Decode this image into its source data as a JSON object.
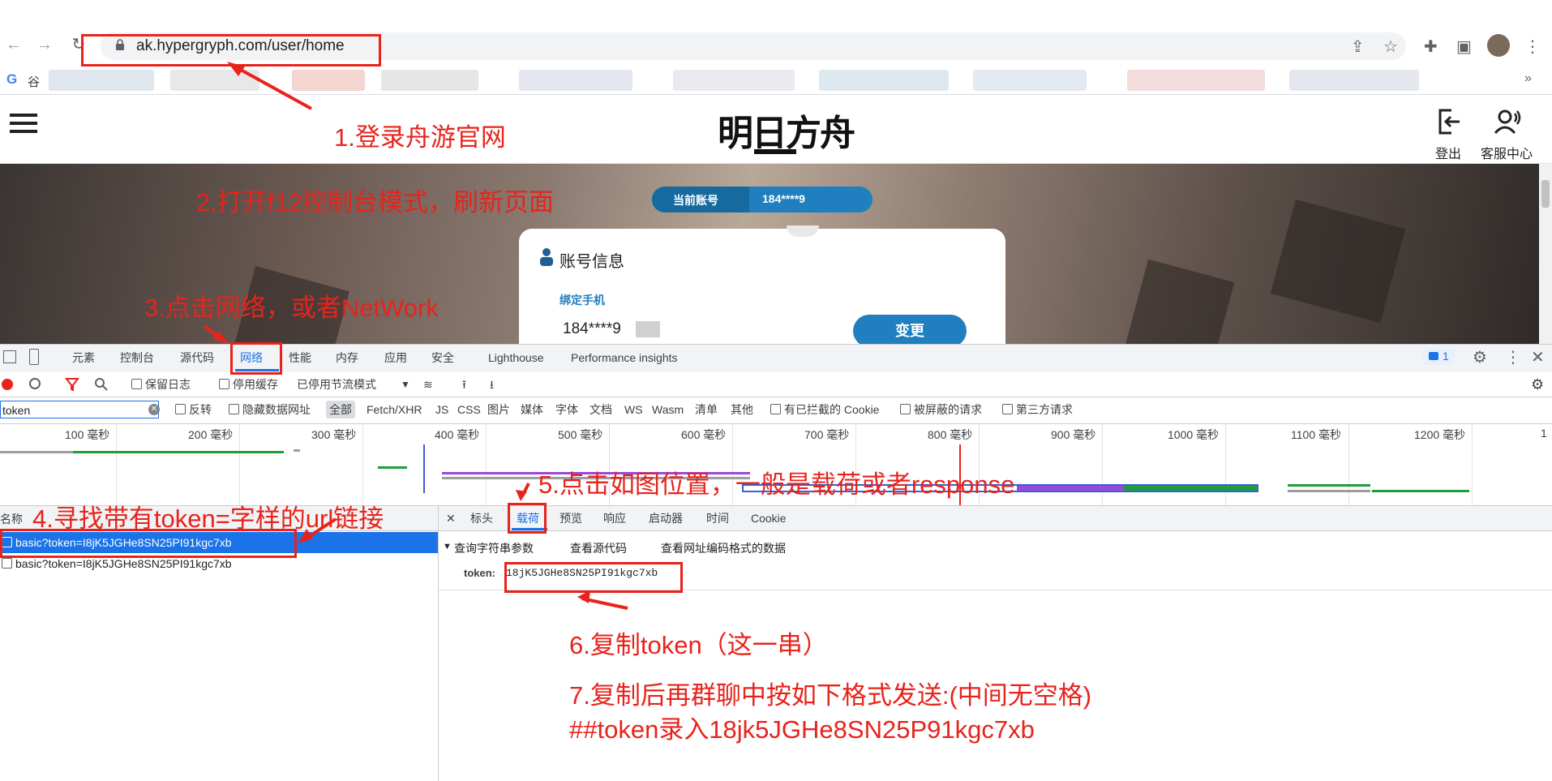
{
  "browser": {
    "url": "ak.hypergryph.com/user/home",
    "bookmark_first": "谷"
  },
  "site": {
    "logo": "明日方舟",
    "logout_label": "登出",
    "support_label": "客服中心",
    "account_pill_label": "当前账号",
    "account_pill_value": "184****9",
    "card_title": "账号信息",
    "bound_phone_label": "绑定手机",
    "bound_phone_value": "184****9",
    "change_button": "变更"
  },
  "devtools": {
    "tabs": [
      "元素",
      "控制台",
      "源代码",
      "网络",
      "性能",
      "内存",
      "应用",
      "安全",
      "Lighthouse",
      "Performance insights"
    ],
    "active_tab": "网络",
    "issues_count": "1",
    "toolbar": {
      "preserve_log": "保留日志",
      "disable_cache": "停用缓存",
      "throttling": "已停用节流模式"
    },
    "filter": {
      "value": "token",
      "invert": "反转",
      "hide_data_urls": "隐藏数据网址",
      "types": [
        "全部",
        "Fetch/XHR",
        "JS",
        "CSS",
        "图片",
        "媒体",
        "字体",
        "文档",
        "WS",
        "Wasm",
        "清单",
        "其他"
      ],
      "blocked_cookies": "有已拦截的 Cookie",
      "blocked_requests": "被屏蔽的请求",
      "third_party": "第三方请求"
    },
    "timeline_ticks": [
      "100 毫秒",
      "200 毫秒",
      "300 毫秒",
      "400 毫秒",
      "500 毫秒",
      "600 毫秒",
      "700 毫秒",
      "800 毫秒",
      "900 毫秒",
      "1000 毫秒",
      "1100 毫秒",
      "1200 毫秒",
      "1"
    ],
    "request_list": {
      "header": "名称",
      "rows": [
        "basic?token=I8jK5JGHe8SN25PI91kgc7xb",
        "basic?token=I8jK5JGHe8SN25PI91kgc7xb"
      ]
    },
    "detail_tabs": [
      "标头",
      "载荷",
      "预览",
      "响应",
      "启动器",
      "时间",
      "Cookie"
    ],
    "active_detail_tab": "载荷",
    "payload": {
      "section": "查询字符串参数",
      "view_source": "查看源代码",
      "view_url_encoded": "查看网址编码格式的数据",
      "key": "token:",
      "value": "18jK5JGHe8SN25PI91kgc7xb"
    }
  },
  "annotations": {
    "step1": "1.登录舟游官网",
    "step2": "2.打开f12控制台模式，刷新页面",
    "step3": "3.点击网络，或者NetWork",
    "step4": "4.寻找带有token=字样的url链接",
    "step5": "5.点击如图位置，一般是载荷或者response",
    "step6": "6.复制token（这一串）",
    "step7_line1": "7.复制后再群聊中按如下格式发送:(中间无空格)",
    "step7_line2": "##token录入18jk5JGHe8SN25P91kgc7xb"
  },
  "colors": {
    "annotation": "#e8231c",
    "accent_blue": "#1a73e8",
    "site_blue": "#1f7fbf"
  }
}
